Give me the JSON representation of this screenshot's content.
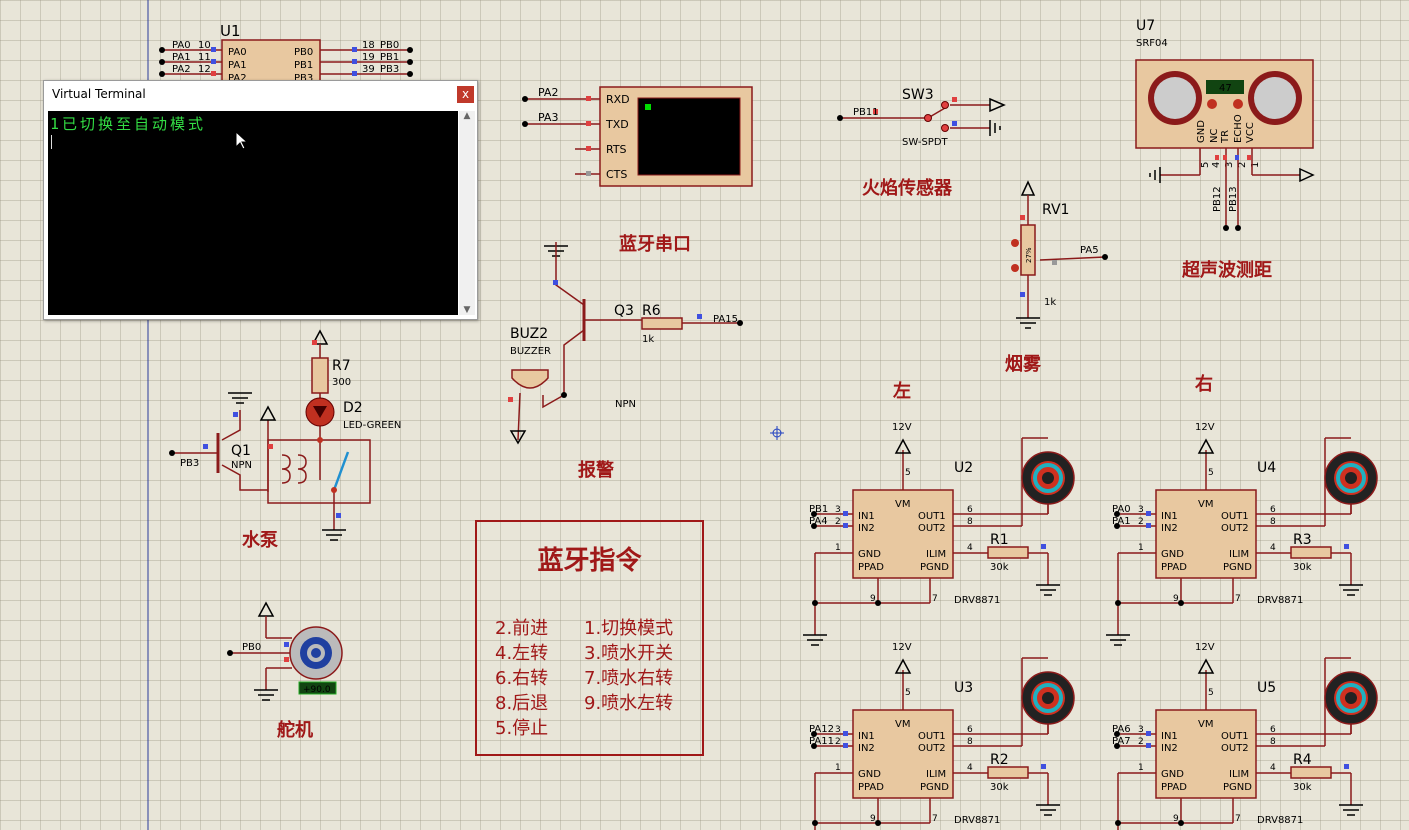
{
  "terminal": {
    "title": "Virtual Terminal",
    "close_glyph": "x",
    "output_line": "1已切换至自动模式"
  },
  "labels": {
    "bluetooth_serial": "蓝牙串口",
    "flame_sensor": "火焰传感器",
    "ultrasonic": "超声波测距",
    "smoke": "烟雾",
    "alarm": "报警",
    "pump": "水泵",
    "servo": "舵机",
    "left": "左",
    "right": "右"
  },
  "commands": {
    "title": "蓝牙指令",
    "items": [
      "2.前进",
      "1.切换模式",
      "4.左转",
      "3.喷水开关",
      "6.右转",
      "7.喷水右转",
      "8.后退",
      "9.喷水左转",
      "5.停止"
    ]
  },
  "components": {
    "u1": {
      "ref": "U1",
      "left_pins": [
        [
          "PA0",
          "10"
        ],
        [
          "PA1",
          "11"
        ],
        [
          "PA2",
          "12"
        ]
      ],
      "right_pins": [
        [
          "PB0",
          "18"
        ],
        [
          "PB1",
          "19"
        ],
        [
          "PB3",
          "39"
        ]
      ],
      "left_names": [
        "PA0",
        "PA1",
        "PA2"
      ],
      "right_names": [
        "PB0",
        "PB1",
        "PB3"
      ]
    },
    "bt": {
      "pins": [
        "RXD",
        "TXD",
        "RTS",
        "CTS"
      ],
      "nets": [
        "PA2",
        "PA3"
      ]
    },
    "sw3": {
      "ref": "SW3",
      "type": "SW-SPDT",
      "net": "PB11"
    },
    "u7": {
      "ref": "U7",
      "type": "SRF04",
      "reading": "47",
      "pins": [
        "GND",
        "NC",
        "TR",
        "ECHO",
        "VCC"
      ],
      "pin_nums": [
        "5",
        "4",
        "3",
        "2",
        "1"
      ],
      "nets": [
        "PB12",
        "PB13"
      ]
    },
    "rv1": {
      "ref": "RV1",
      "value": "1k",
      "net": "PA5",
      "pct": "27%"
    },
    "q3": {
      "ref": "Q3",
      "type": "NPN"
    },
    "r6": {
      "ref": "R6",
      "value": "1k",
      "net": "PA15"
    },
    "buz2": {
      "ref": "BUZ2",
      "type": "BUZZER"
    },
    "r7": {
      "ref": "R7",
      "value": "300"
    },
    "d2": {
      "ref": "D2",
      "type": "LED-GREEN"
    },
    "q1": {
      "ref": "Q1",
      "type": "NPN",
      "net": "PB3"
    },
    "servo": {
      "net": "PB0",
      "reading": "+90.0"
    },
    "drivers": [
      {
        "ref": "U2",
        "nets": [
          "PB1",
          "PA4"
        ],
        "res_ref": "R1",
        "res_val": "30k",
        "supply": "12V",
        "type": "DRV8871"
      },
      {
        "ref": "U4",
        "nets": [
          "PA0",
          "PA1"
        ],
        "res_ref": "R3",
        "res_val": "30k",
        "supply": "12V",
        "type": "DRV8871"
      },
      {
        "ref": "U3",
        "nets": [
          "PA12",
          "PA11"
        ],
        "res_ref": "R2",
        "res_val": "30k",
        "supply": "12V",
        "type": "DRV8871"
      },
      {
        "ref": "U5",
        "nets": [
          "PA6",
          "PA7"
        ],
        "res_ref": "R4",
        "res_val": "30k",
        "supply": "12V",
        "type": "DRV8871"
      }
    ],
    "drv_pins": {
      "in1": "IN1",
      "in2": "IN2",
      "vm": "VM",
      "out1": "OUT1",
      "out2": "OUT2",
      "gnd": "GND",
      "ppad": "PPAD",
      "ilim": "ILIM",
      "pgnd": "PGND",
      "n_in1": "3",
      "n_in2": "2",
      "n_vm": "5",
      "n_out1": "6",
      "n_out2": "8",
      "n_gnd": "1",
      "n_ilim": "4",
      "n_ppad": "9",
      "n_pgnd": "7"
    }
  },
  "colors": {
    "wire": "#8b1a1a",
    "chip_fill": "#e8c8a0",
    "label": "#a01818",
    "pin_red": "#e04040",
    "pin_blue": "#4050e0",
    "terminal_text": "#33dd44"
  }
}
